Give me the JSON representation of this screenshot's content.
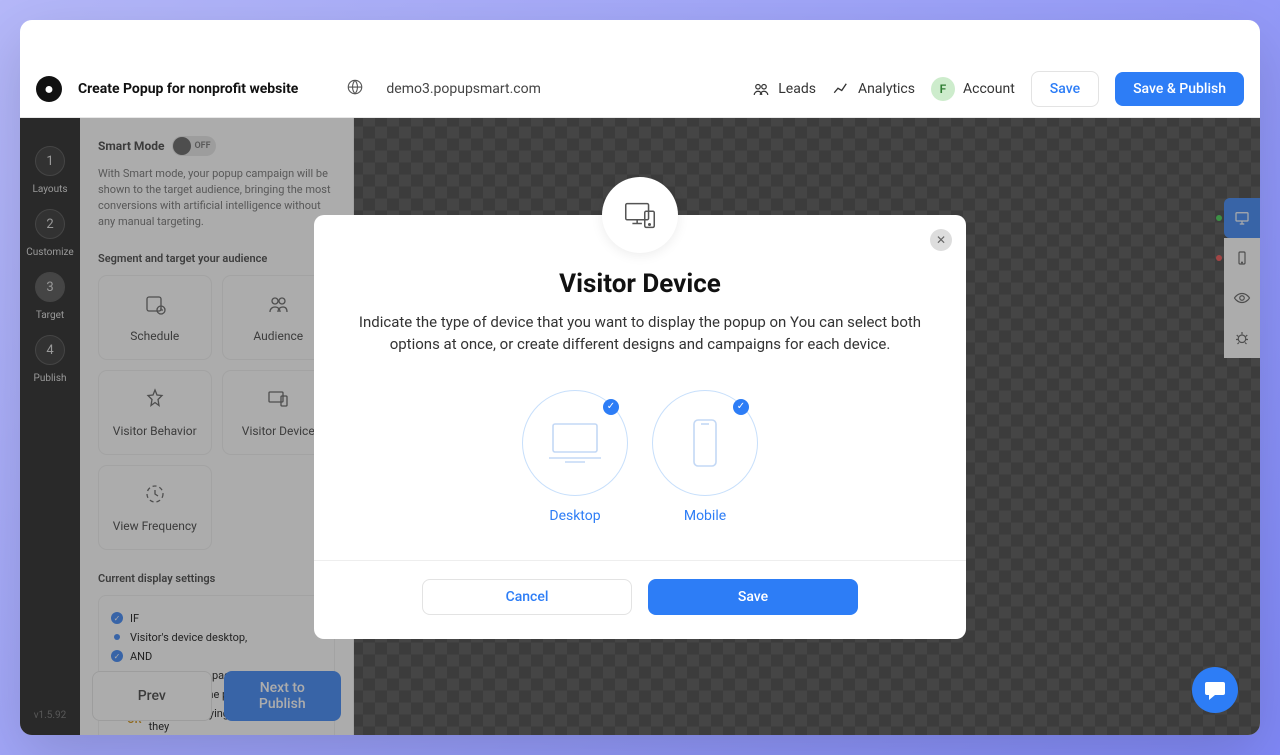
{
  "header": {
    "page_title": "Create Popup for nonprofit website",
    "site_url": "demo3.popupsmart.com",
    "leads": "Leads",
    "analytics": "Analytics",
    "account": "Account",
    "avatar_initial": "F",
    "save": "Save",
    "save_publish": "Save & Publish"
  },
  "steps": {
    "s1": {
      "num": "1",
      "label": "Layouts"
    },
    "s2": {
      "num": "2",
      "label": "Customize"
    },
    "s3": {
      "num": "3",
      "label": "Target"
    },
    "s4": {
      "num": "4",
      "label": "Publish"
    }
  },
  "version": "v1.5.92",
  "sidebar": {
    "smart_mode_label": "Smart Mode",
    "toggle_state": "OFF",
    "smart_desc": "With Smart mode, your popup campaign will be shown to the target audience, bringing the most conversions with artificial intelligence without any manual targeting.",
    "segment_label": "Segment and target your audience",
    "cards": {
      "schedule": "Schedule",
      "audience": "Audience",
      "behavior": "Visitor Behavior",
      "device": "Visitor Device",
      "frequency": "View Frequency"
    },
    "current_label": "Current display settings",
    "rules": {
      "if": "IF",
      "device": "Visitor's device desktop,",
      "and": "AND",
      "every": "Display on every page view.",
      "show": "Show showing the popup",
      "or": "OR",
      "stop2": "- Stop displaying to visitor after they"
    },
    "prev": "Prev",
    "next": "Next to Publish"
  },
  "modal": {
    "title": "Visitor Device",
    "desc": "Indicate the type of device that you want to display the popup on You can select both options at once, or create different designs and campaigns for each device.",
    "desktop": "Desktop",
    "mobile": "Mobile",
    "cancel": "Cancel",
    "save": "Save"
  }
}
